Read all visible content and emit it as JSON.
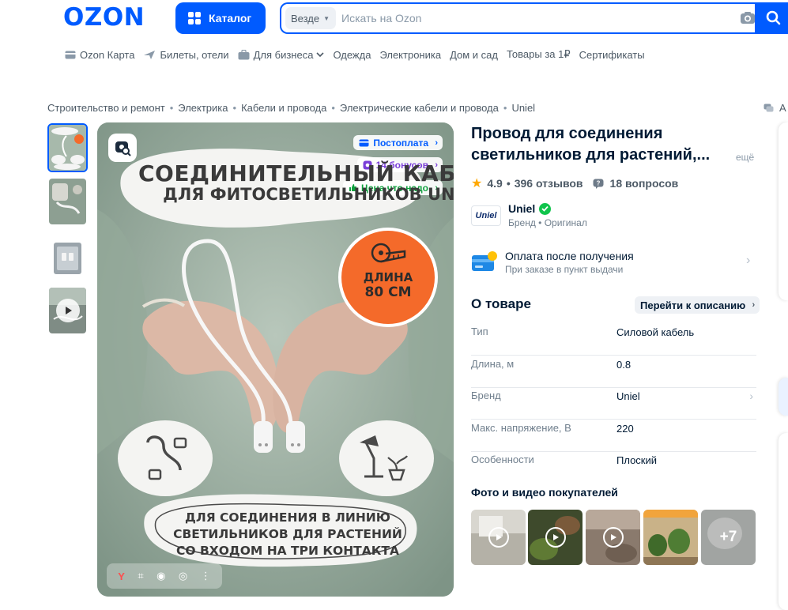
{
  "header": {
    "logo": "OZON",
    "catalog_label": "Каталог",
    "search_scope": "Везде",
    "search_placeholder": "Искать на Ozon"
  },
  "subnav": [
    {
      "label": "Ozon Карта",
      "icon": "card-icon"
    },
    {
      "label": "Билеты, отели",
      "icon": "plane-icon"
    },
    {
      "label": "Для бизнеса",
      "icon": "briefcase-icon"
    },
    {
      "label": "Одежда"
    },
    {
      "label": "Электроника"
    },
    {
      "label": "Дом и сад"
    },
    {
      "label": "Товары за 1₽"
    },
    {
      "label": "Сертификаты"
    }
  ],
  "breadcrumbs": [
    "Строительство и ремонт",
    "Электрика",
    "Кабели и провода",
    "Электрические кабели и провода",
    "Uniel"
  ],
  "breadcrumb_right": "А",
  "gallery": {
    "badges": {
      "postpay": "Постоплата",
      "bonus": "14 бонусов",
      "price": "Цена что надо"
    },
    "main_text_line1": "СОЕДИНИТЕЛЬНЫЙ КАБЕЛЬ",
    "main_text_line2": "ДЛЯ ФИТОСВЕТИЛЬНИКОВ UNIEL",
    "length_label": "ДЛИНА",
    "length_value": "80 СМ",
    "bottom_line1": "ДЛЯ СОЕДИНЕНИЯ В ЛИНИЮ",
    "bottom_line2": "СВЕТИЛЬНИКОВ ДЛЯ РАСТЕНИЙ",
    "bottom_line3": "СО ВХОДОМ НА ТРИ КОНТАКТА"
  },
  "product": {
    "title": "Провод для соединения светильников для растений,...",
    "title_more": "ещё",
    "rating": "4.9",
    "reviews": "396 отзывов",
    "questions": "18 вопросов",
    "brand_logo_text": "Uniel",
    "brand_name": "Uniel",
    "brand_sub": "Бренд • Оригинал",
    "pay_title": "Оплата после получения",
    "pay_sub": "При заказе в пункт выдачи"
  },
  "about": {
    "heading": "О товаре",
    "goto": "Перейти к описанию",
    "specs": [
      {
        "key": "Тип",
        "value": "Силовой кабель"
      },
      {
        "key": "Длина, м",
        "value": "0.8"
      },
      {
        "key": "Бренд",
        "value": "Uniel"
      },
      {
        "key": "Макс. напряжение, В",
        "value": "220"
      },
      {
        "key": "Особенности",
        "value": "Плоский"
      }
    ]
  },
  "photos": {
    "heading": "Фото и видео покупателей",
    "more": "+7"
  },
  "colors": {
    "brand_blue": "#005bff",
    "text": "#001a34",
    "muted": "#707f8d",
    "orange_badge": "#f46a2a",
    "star": "#ffa800",
    "verified": "#10c44c"
  }
}
